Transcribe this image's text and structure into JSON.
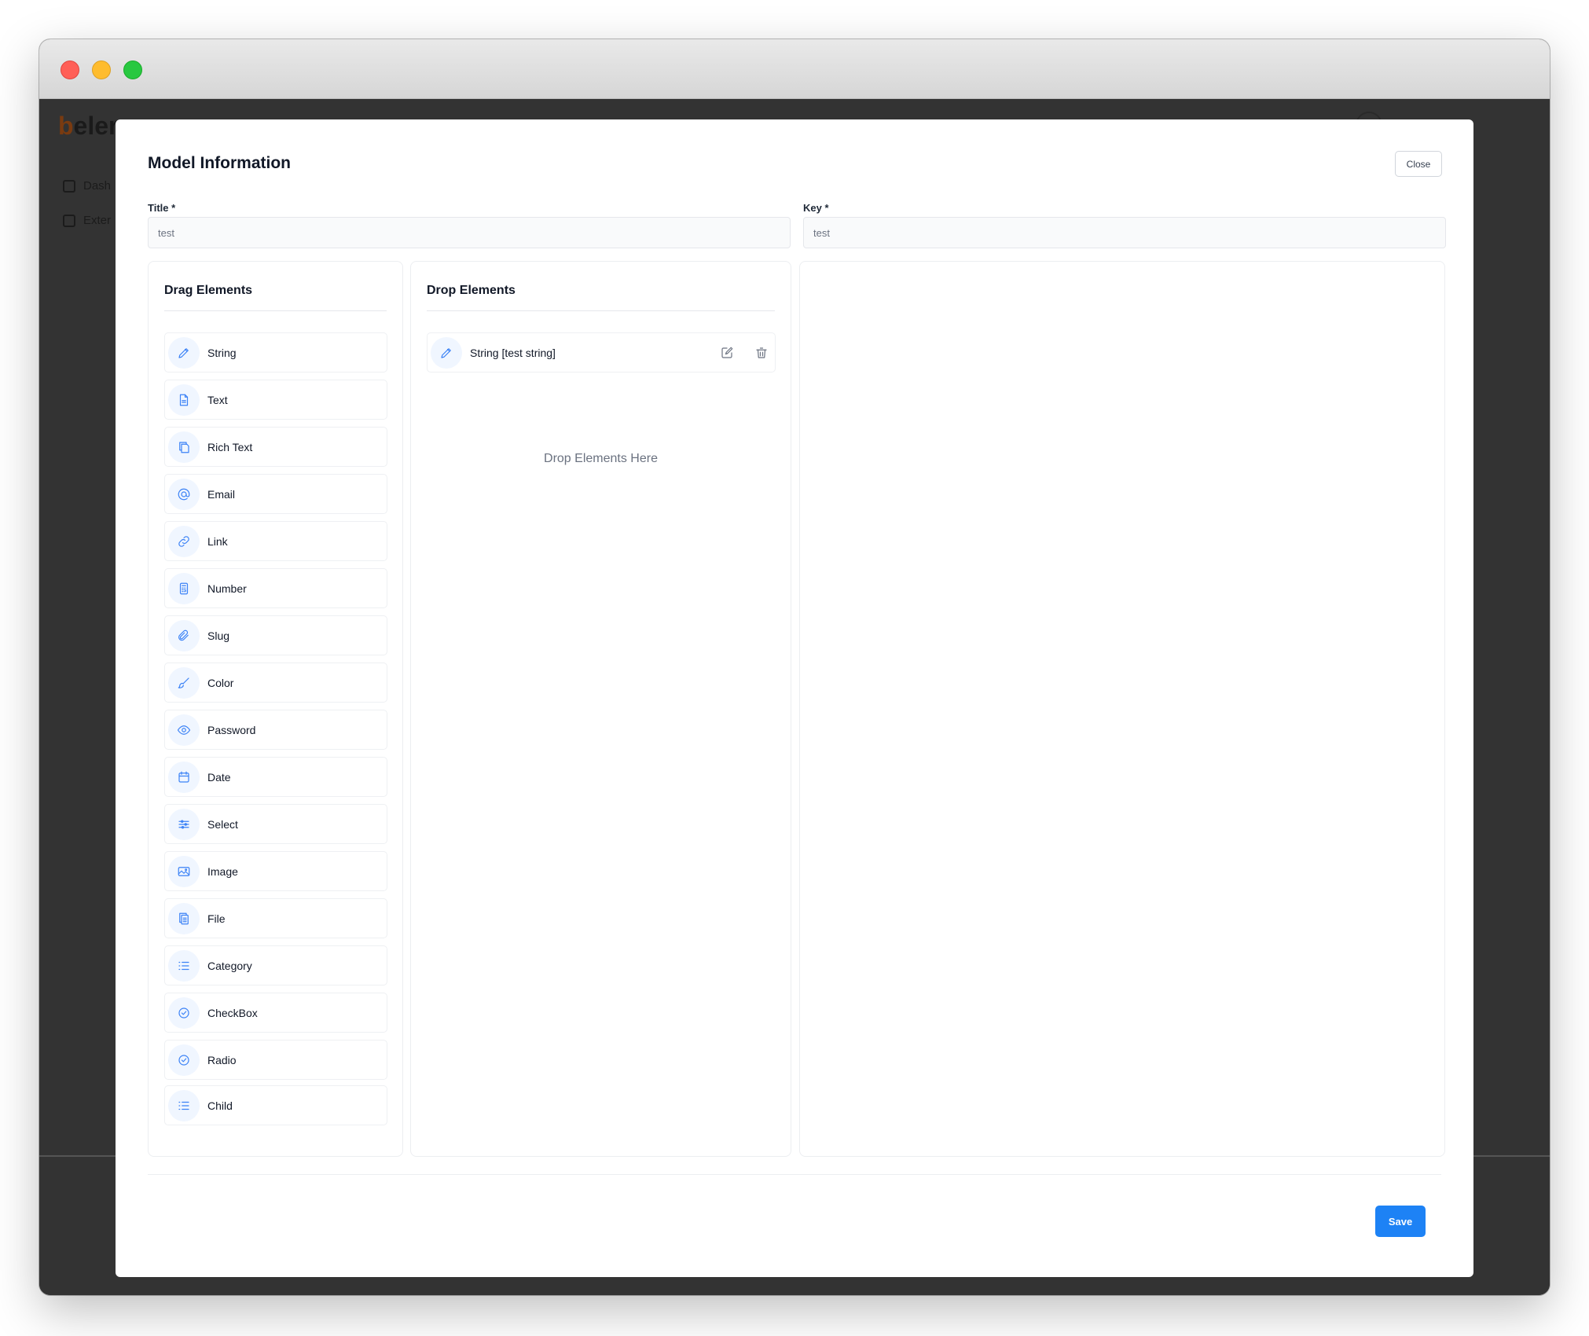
{
  "background_app": {
    "logo_text": "eler",
    "nav_items": [
      {
        "label": "Dash"
      },
      {
        "label": "Exter"
      }
    ]
  },
  "modal": {
    "title": "Model Information",
    "close_label": "Close",
    "title_field": {
      "label": "Title *",
      "value": "test"
    },
    "key_field": {
      "label": "Key *",
      "value": "test"
    },
    "save_label": "Save"
  },
  "drag_panel": {
    "heading": "Drag Elements",
    "items": [
      {
        "label": "String",
        "icon": "pencil-icon"
      },
      {
        "label": "Text",
        "icon": "document-icon"
      },
      {
        "label": "Rich Text",
        "icon": "copy-document-icon"
      },
      {
        "label": "Email",
        "icon": "at-sign-icon"
      },
      {
        "label": "Link",
        "icon": "link-icon"
      },
      {
        "label": "Number",
        "icon": "calculator-icon"
      },
      {
        "label": "Slug",
        "icon": "paperclip-icon"
      },
      {
        "label": "Color",
        "icon": "brush-icon"
      },
      {
        "label": "Password",
        "icon": "eye-icon"
      },
      {
        "label": "Date",
        "icon": "calendar-icon"
      },
      {
        "label": "Select",
        "icon": "sliders-icon"
      },
      {
        "label": "Image",
        "icon": "image-icon"
      },
      {
        "label": "File",
        "icon": "files-icon"
      },
      {
        "label": "Category",
        "icon": "list-icon"
      },
      {
        "label": "CheckBox",
        "icon": "check-circle-icon"
      },
      {
        "label": "Radio",
        "icon": "check-circle-icon"
      },
      {
        "label": "Child",
        "icon": "list-icon"
      }
    ]
  },
  "drop_panel": {
    "heading": "Drop Elements",
    "items": [
      {
        "label": "String [test string]",
        "icon": "pencil-icon"
      }
    ],
    "hint": "Drop Elements Here"
  },
  "colors": {
    "accent": "#1d82f5",
    "icon_blue": "#3b82f6",
    "icon_bg": "#f0f6ff",
    "overlay": "#333333"
  }
}
